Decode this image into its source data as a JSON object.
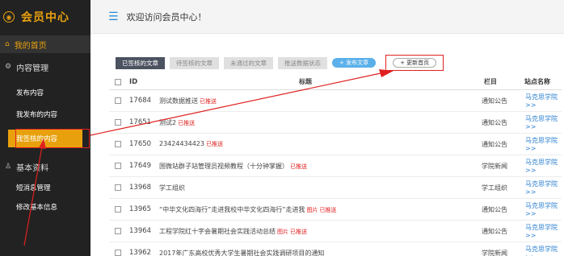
{
  "brand": {
    "title": "会员中心",
    "icon": "user-circle-icon"
  },
  "header": {
    "welcome": "欢迎访问会员中心！",
    "icon": "menu-list-icon"
  },
  "sidebar": {
    "home": "我的首页",
    "group1": "内容管理",
    "items1": [
      "发布内容",
      "我发布的内容",
      "我签核的内容"
    ],
    "group2": "基本资料",
    "items2": [
      "短消息管理",
      "修改基本信息"
    ]
  },
  "tabs": [
    "已签核的文章",
    "待签核的文章",
    "未通过的文章",
    "推送数据状态"
  ],
  "buttons": {
    "publish": "+ 发布文章",
    "update": "+ 更新首页"
  },
  "table": {
    "headers": {
      "id": "ID",
      "title": "标题",
      "column": "栏目",
      "site": "站点名称"
    },
    "rows": [
      {
        "id": "17684",
        "title": "测试数据推送",
        "tags": [
          "已推送"
        ],
        "column": "通知公告",
        "site": "马克思学院>>"
      },
      {
        "id": "17651",
        "title": "测试2",
        "tags": [
          "已推送"
        ],
        "column": "通知公告",
        "site": "马克思学院>>"
      },
      {
        "id": "17650",
        "title": "23424434423",
        "tags": [
          "已推送"
        ],
        "column": "通知公告",
        "site": "马克思学院>>"
      },
      {
        "id": "17649",
        "title": "国微站群子站管理员视频教程（十分钟掌握）",
        "tags": [
          "已推送"
        ],
        "column": "学院新闻",
        "site": "马克思学院>>"
      },
      {
        "id": "13968",
        "title": "学工组织",
        "tags": [],
        "column": "学工组织",
        "site": "马克思学院>>"
      },
      {
        "id": "13965",
        "title": "“中华文化四海行”走进我校中华文化四海行”走进我",
        "tags": [
          "图片",
          "已推送"
        ],
        "column": "通知公告",
        "site": "马克思学院>>"
      },
      {
        "id": "13964",
        "title": "工程学院红十字会暑期社会实践活动总结",
        "tags": [
          "图片",
          "已推送"
        ],
        "column": "通知公告",
        "site": "马克思学院>>"
      },
      {
        "id": "13962",
        "title": "2017年广东高校优秀大学生暑期社会实践调研项目的通知",
        "tags": [],
        "column": "学院新闻",
        "site": "马克思学院>>"
      }
    ]
  }
}
